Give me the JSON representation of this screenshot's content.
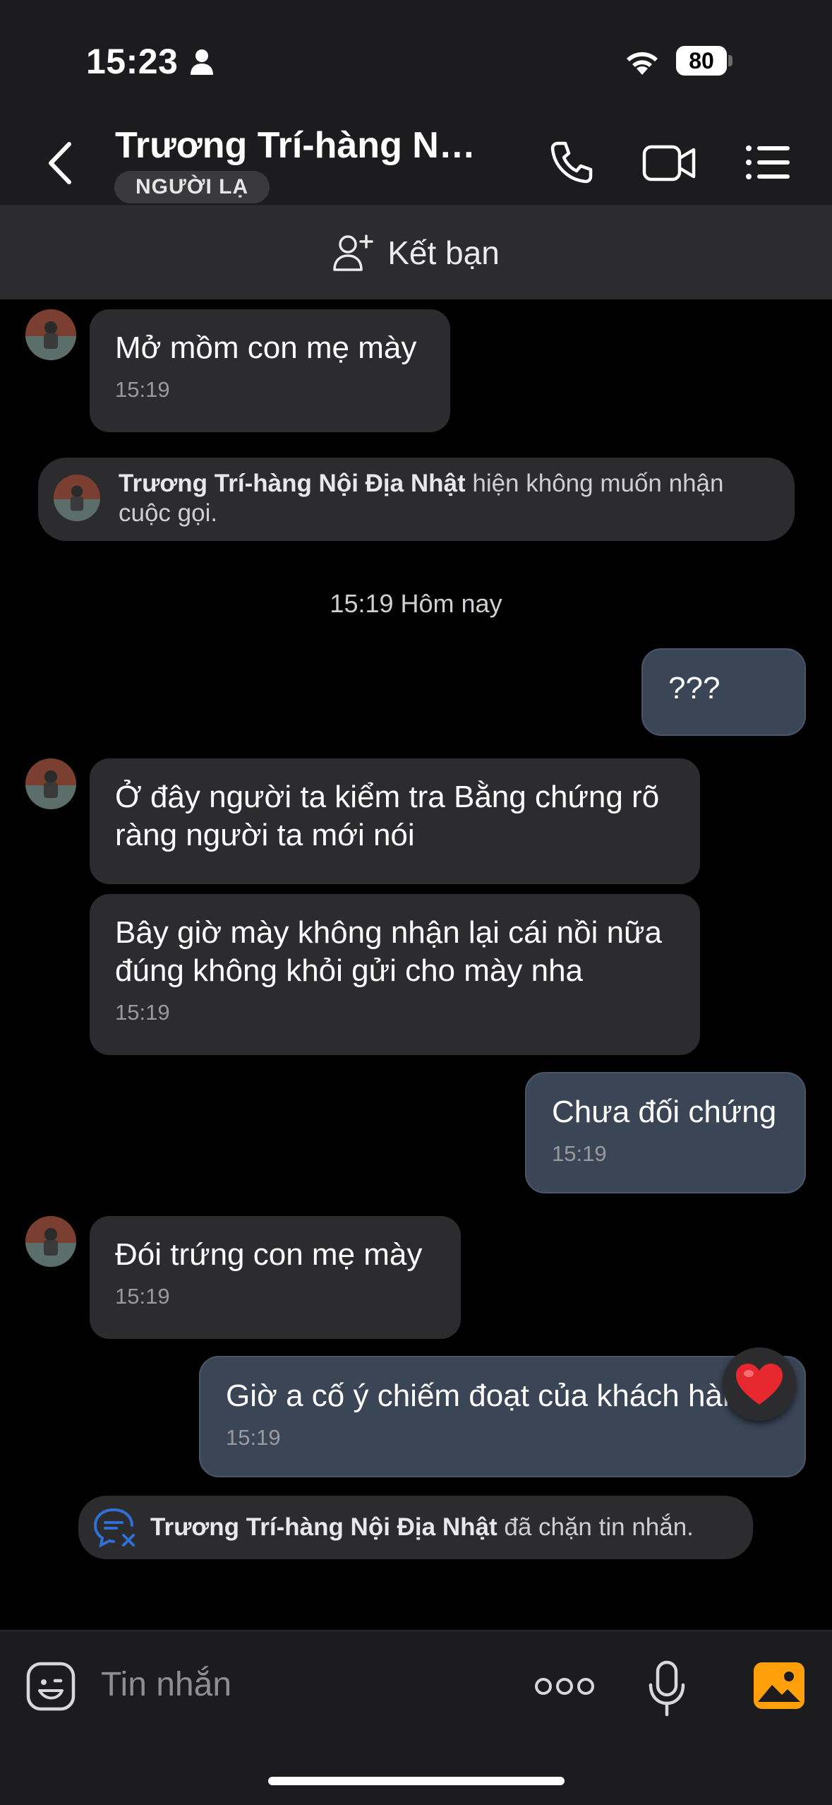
{
  "status_bar": {
    "time": "15:23",
    "battery": "80"
  },
  "header": {
    "contact_name": "Trương Trí-hàng Nội...",
    "badge": "NGƯỜI LẠ"
  },
  "add_friend": {
    "label": "Kết bạn"
  },
  "messages": {
    "m1": {
      "text": "Mở mồm con mẹ mày",
      "time": "15:19"
    },
    "call_notice": {
      "name": "Trương Trí-hàng Nội Địa Nhật",
      "text": " hiện không muốn nhận cuộc gọi."
    },
    "date_separator": "15:19 Hôm nay",
    "m2": {
      "text": "???"
    },
    "m3": {
      "text": "Ở đây người ta kiểm tra Bằng chứng rõ ràng người ta mới nói"
    },
    "m4": {
      "text": "Bây giờ mày không nhận lại cái nồi nữa đúng không khỏi gửi cho mày nha",
      "time": "15:19"
    },
    "m5": {
      "text": "Chưa đối chứng",
      "time": "15:19"
    },
    "m6": {
      "text": "Đói trứng con mẹ mày",
      "time": "15:19"
    },
    "m7": {
      "text": "Giờ a cố ý chiếm đoạt của khách hàng",
      "time": "15:19",
      "reaction": "heart"
    },
    "block_notice": {
      "name": "Trương Trí-hàng Nội Địa Nhật",
      "text": " đã chặn tin nhắn."
    }
  },
  "composer": {
    "placeholder": "Tin nhắn"
  },
  "colors": {
    "accent": "#ff9f0a",
    "bubble_out": "#3a4556",
    "bubble_in": "#2c2c2e",
    "block_icon": "#2f6fd6"
  }
}
